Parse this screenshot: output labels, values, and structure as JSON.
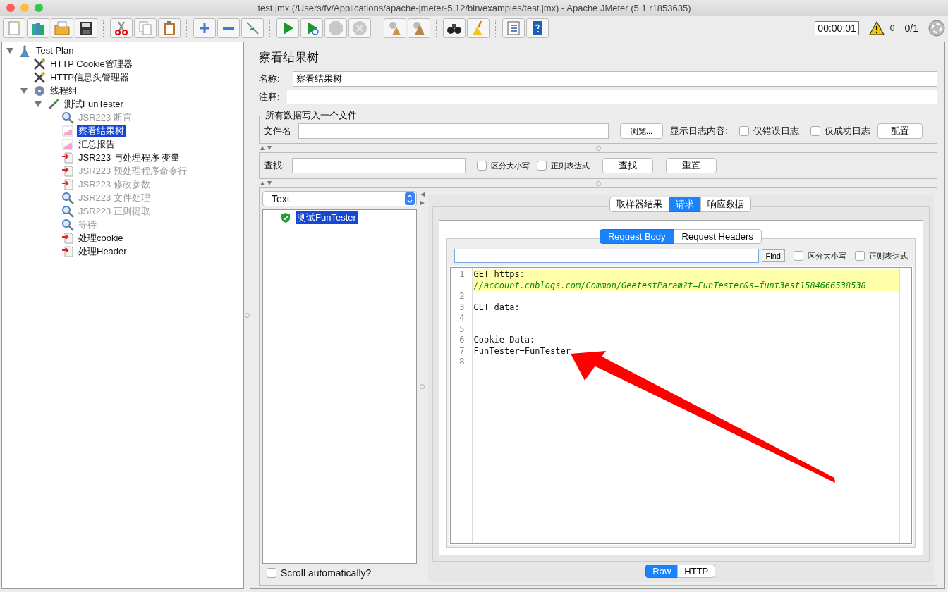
{
  "window": {
    "title": "test.jmx (/Users/fv/Applications/apache-jmeter-5.12/bin/examples/test.jmx) - Apache JMeter (5.1 r1853635)"
  },
  "toolbar": [
    {
      "kind": "new",
      "disabled": false
    },
    {
      "kind": "templates",
      "disabled": false
    },
    {
      "kind": "open",
      "disabled": false
    },
    {
      "kind": "save",
      "disabled": false
    },
    {
      "kind": "cut",
      "disabled": false
    },
    {
      "kind": "copy",
      "disabled": false
    },
    {
      "kind": "paste",
      "disabled": false
    },
    {
      "kind": "expand",
      "disabled": false
    },
    {
      "kind": "collapse",
      "disabled": false
    },
    {
      "kind": "toggle",
      "disabled": false
    },
    {
      "kind": "start",
      "disabled": false
    },
    {
      "kind": "start-no-pause",
      "disabled": false
    },
    {
      "kind": "stop",
      "disabled": true
    },
    {
      "kind": "shutdown",
      "disabled": true
    },
    {
      "kind": "clear",
      "disabled": false
    },
    {
      "kind": "clear-all",
      "disabled": false
    },
    {
      "kind": "search",
      "disabled": false
    },
    {
      "kind": "reset-search",
      "disabled": false
    },
    {
      "kind": "function-helper",
      "disabled": false
    },
    {
      "kind": "help",
      "disabled": false
    }
  ],
  "status": {
    "timer": "00:00:01",
    "warnings": "0",
    "threads": "0/1"
  },
  "tree": [
    {
      "label": "Test Plan",
      "kind": "plan",
      "disabled": false,
      "selected": false,
      "expanded": true,
      "children": [
        {
          "label": "HTTP Cookie管理器",
          "kind": "config",
          "disabled": false,
          "selected": false
        },
        {
          "label": "HTTP信息头管理器",
          "kind": "config",
          "disabled": false,
          "selected": false
        },
        {
          "label": "线程组",
          "kind": "thread-group",
          "disabled": false,
          "selected": false,
          "expanded": true,
          "children": [
            {
              "label": "测试FunTester",
              "kind": "sampler",
              "disabled": false,
              "selected": false,
              "expanded": true,
              "children": [
                {
                  "label": "JSR223 断言",
                  "kind": "assertion",
                  "disabled": true,
                  "selected": false
                },
                {
                  "label": "察看结果树",
                  "kind": "listener",
                  "disabled": false,
                  "selected": true
                },
                {
                  "label": "汇总报告",
                  "kind": "listener",
                  "disabled": false,
                  "selected": false
                },
                {
                  "label": "JSR223 与处理程序 变量",
                  "kind": "processor",
                  "disabled": false,
                  "selected": false
                },
                {
                  "label": "JSR223 预处理程序命令行",
                  "kind": "processor",
                  "disabled": true,
                  "selected": false
                },
                {
                  "label": "JSR223 修改参数",
                  "kind": "processor",
                  "disabled": true,
                  "selected": false
                },
                {
                  "label": "JSR223 文件处理",
                  "kind": "assertion",
                  "disabled": true,
                  "selected": false
                },
                {
                  "label": "JSR223 正则提取",
                  "kind": "assertion",
                  "disabled": true,
                  "selected": false
                },
                {
                  "label": "等待",
                  "kind": "assertion",
                  "disabled": true,
                  "selected": false
                },
                {
                  "label": "处理cookie",
                  "kind": "processor",
                  "disabled": false,
                  "selected": false
                },
                {
                  "label": "处理Header",
                  "kind": "processor",
                  "disabled": false,
                  "selected": false
                }
              ]
            }
          ]
        }
      ]
    }
  ],
  "panel": {
    "title": "察看结果树",
    "name_label": "名称:",
    "name_value": "察看结果树",
    "comment_label": "注释:",
    "file_group": {
      "legend": "所有数据写入一个文件",
      "file_label": "文件名",
      "browse": "浏览...",
      "log_label": "显示日志内容:",
      "checkboxes": [
        {
          "label": "仅错误日志",
          "checked": false
        },
        {
          "label": "仅成功日志",
          "checked": false
        }
      ],
      "configure": "配置"
    }
  },
  "search": {
    "label": "查找:",
    "checkboxes": [
      {
        "label": "区分大小写",
        "checked": false
      },
      {
        "label": "正则表达式",
        "checked": false
      }
    ],
    "buttons": [
      "查找",
      "重置"
    ]
  },
  "results": {
    "renderer": "Text",
    "items": [
      {
        "label": "测试FunTester",
        "selected": true
      }
    ],
    "scroll": {
      "label": "Scroll automatically?",
      "checked": false
    }
  },
  "tabs": [
    {
      "label": "取样器结果",
      "selected": false
    },
    {
      "label": "请求",
      "selected": true
    },
    {
      "label": "响应数据",
      "selected": false
    }
  ],
  "sub_tabs": [
    {
      "label": "Request Body",
      "selected": true
    },
    {
      "label": "Request Headers",
      "selected": false
    }
  ],
  "find": {
    "button": "Find",
    "checkboxes": [
      {
        "label": "区分大小写",
        "checked": false
      },
      {
        "label": "正则表达式",
        "checked": false
      }
    ]
  },
  "code": [
    {
      "number": "1",
      "text": "GET https:",
      "continuation": "//account.cnblogs.com/Common/GeetestParam?t=FunTester&s=funt3est1584666538538",
      "highlighted": true
    },
    {
      "number": "2",
      "highlighted": false
    },
    {
      "number": "3",
      "text": "GET data:",
      "highlighted": false
    },
    {
      "number": "4",
      "highlighted": false
    },
    {
      "number": "5",
      "highlighted": false
    },
    {
      "number": "6",
      "text": "Cookie Data:",
      "highlighted": false
    },
    {
      "number": "7",
      "text": "FunTester=FunTester",
      "highlighted": false
    },
    {
      "number": "8",
      "highlighted": false
    }
  ],
  "bottom_tabs": [
    {
      "label": "Raw",
      "selected": true
    },
    {
      "label": "HTTP",
      "selected": false
    }
  ]
}
